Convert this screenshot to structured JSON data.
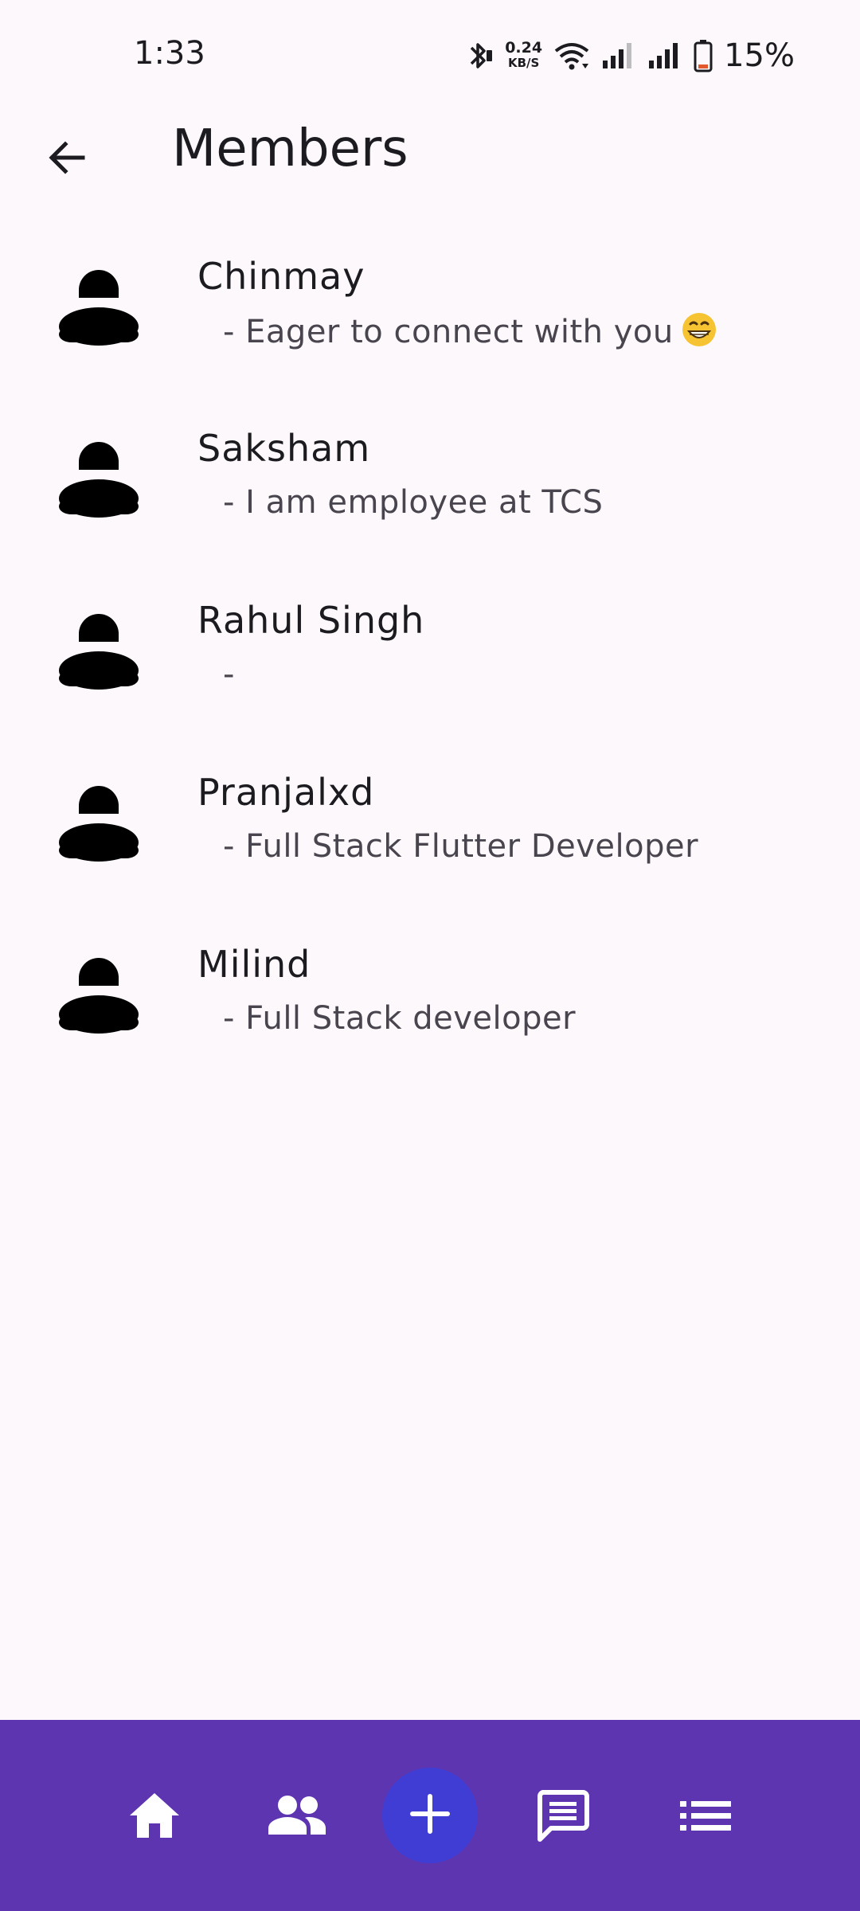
{
  "status_bar": {
    "time": "1:33",
    "net_speed_value": "0.24",
    "net_speed_unit": "KB/S",
    "battery_percent": "15%",
    "icons": [
      "bluetooth-icon",
      "wifi-icon",
      "signal-icon",
      "signal-icon",
      "battery-icon"
    ]
  },
  "app_bar": {
    "title": "Members",
    "back_icon": "arrow-back-icon"
  },
  "members": [
    {
      "name": "Chinmay",
      "bio": "- Eager to connect with you",
      "bio_emoji": "grinning-face"
    },
    {
      "name": "Saksham",
      "bio": "- I am employee at TCS"
    },
    {
      "name": "Rahul Singh",
      "bio": "-"
    },
    {
      "name": "Pranjalxd",
      "bio": "- Full Stack Flutter Developer"
    },
    {
      "name": "Milind",
      "bio": "- Full Stack developer"
    }
  ],
  "bottom_nav": {
    "items": [
      "home-icon",
      "people-icon",
      "add-icon",
      "chat-icon",
      "list-icon"
    ]
  },
  "colors": {
    "background": "#fdf8fc",
    "bottom_nav": "#5e35b1",
    "fab": "#3f3dd4",
    "text_primary": "#1c1b1f",
    "text_secondary": "#49454f"
  }
}
